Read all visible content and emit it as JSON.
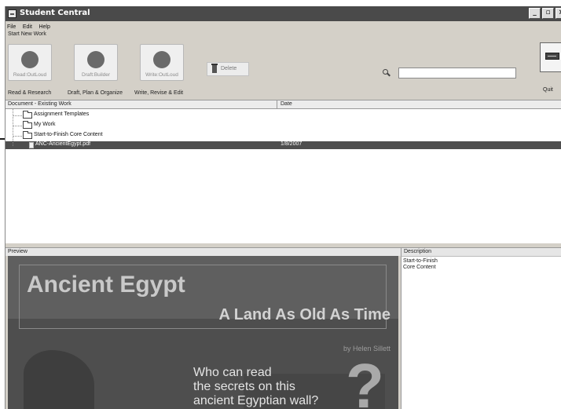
{
  "window": {
    "title": "Student Central",
    "controls": [
      "_",
      "▫",
      "×"
    ]
  },
  "menu": [
    "File",
    "Edit",
    "Help"
  ],
  "toolbar": {
    "start_new_label": "Start New Work",
    "buttons": [
      {
        "label": "Read:OutLoud",
        "icon": "read-outloud-icon",
        "group": "Read & Research"
      },
      {
        "label": "Draft:Builder",
        "icon": "draft-builder-icon",
        "group": "Draft, Plan & Organize"
      },
      {
        "label": "Write:OutLoud",
        "icon": "write-outloud-icon",
        "group": "Write, Revise & Edit"
      }
    ],
    "delete_label": "Delete",
    "search_placeholder": "",
    "quit_label": "Quit"
  },
  "list": {
    "columns": [
      "Document - Existing Work",
      "Date"
    ],
    "rows": [
      {
        "label": "Assignment Templates",
        "type": "folder",
        "date": ""
      },
      {
        "label": "My Work",
        "type": "folder",
        "date": ""
      },
      {
        "label": "Start-to-Finish Core Content",
        "type": "folder",
        "date": ""
      },
      {
        "label": "ANC-AncientEgypt.pdf",
        "type": "file",
        "date": "1/8/2007",
        "selected": true
      }
    ]
  },
  "preview": {
    "header": "Preview",
    "title": "Ancient Egypt",
    "subtitle": "A Land As Old As Time",
    "author": "by Helen Sillett",
    "question_lines": [
      "Who can read",
      "the secrets on this",
      "ancient Egyptian wall?"
    ],
    "question_mark": "?"
  },
  "description": {
    "header": "Description",
    "lines": [
      "Start-to-Finish",
      "Core Content"
    ]
  },
  "colors": {
    "titlebar": "#4a4a4a",
    "selected_row": "#4e4e4e",
    "chrome": "#d4d0c8"
  }
}
